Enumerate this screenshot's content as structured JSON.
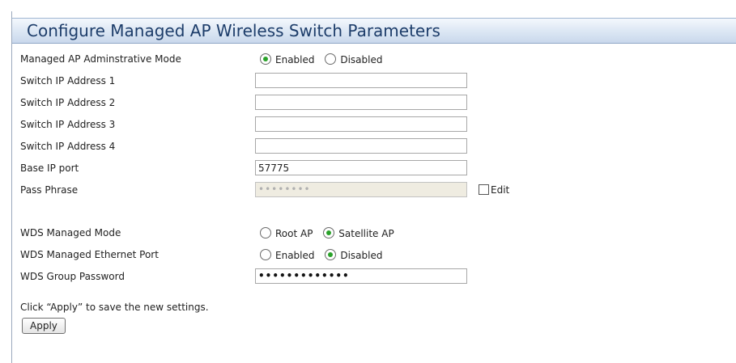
{
  "page": {
    "title": "Configure Managed AP Wireless Switch Parameters"
  },
  "fields": {
    "admin_mode": {
      "label": "Managed AP Adminstrative Mode",
      "options": [
        "Enabled",
        "Disabled"
      ],
      "selected": "Enabled"
    },
    "switch_ip_1": {
      "label": "Switch IP Address 1",
      "value": ""
    },
    "switch_ip_2": {
      "label": "Switch IP Address 2",
      "value": ""
    },
    "switch_ip_3": {
      "label": "Switch IP Address 3",
      "value": ""
    },
    "switch_ip_4": {
      "label": "Switch IP Address 4",
      "value": ""
    },
    "base_ip_port": {
      "label": "Base IP port",
      "value": "57775"
    },
    "pass_phrase": {
      "label": "Pass Phrase",
      "masked_value": "••••••••",
      "edit_label": "Edit",
      "edit_checked": false
    },
    "wds_managed_mode": {
      "label": "WDS Managed Mode",
      "options": [
        "Root AP",
        "Satellite AP"
      ],
      "selected": "Satellite AP"
    },
    "wds_ethernet_port": {
      "label": "WDS Managed Ethernet Port",
      "options": [
        "Enabled",
        "Disabled"
      ],
      "selected": "Disabled"
    },
    "wds_group_password": {
      "label": "WDS Group Password",
      "masked_value": "•••••••••••••"
    }
  },
  "footer": {
    "note": "Click “Apply” to save the new settings.",
    "apply_label": "Apply"
  },
  "colors": {
    "title_text": "#1d3d6a",
    "radio_selected": "#2aa22a",
    "disabled_field_bg": "#efece1"
  }
}
